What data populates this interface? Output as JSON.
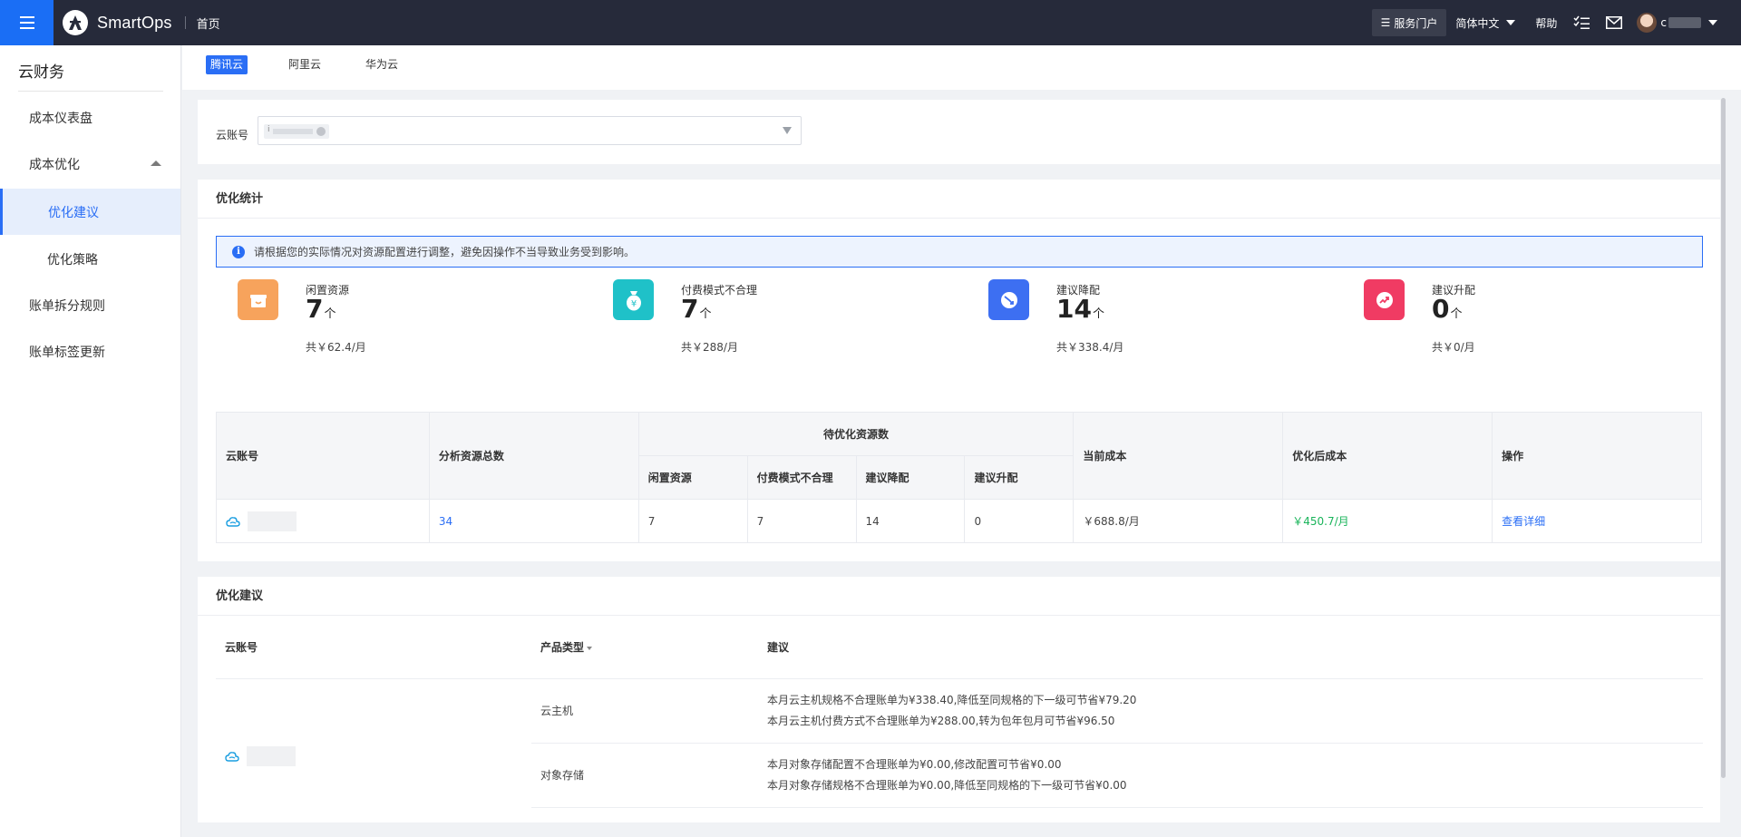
{
  "topbar": {
    "app_name": "SmartOps",
    "home": "首页",
    "portal": "服务门户",
    "language": "简体中文",
    "help": "帮助",
    "user_name": "c"
  },
  "sidebar": {
    "title": "云财务",
    "items": [
      {
        "label": "成本仪表盘"
      },
      {
        "label": "成本优化"
      },
      {
        "label": "优化建议"
      },
      {
        "label": "优化策略"
      },
      {
        "label": "账单拆分规则"
      },
      {
        "label": "账单标签更新"
      }
    ]
  },
  "tabs": [
    {
      "label": "腾讯云",
      "active": true
    },
    {
      "label": "阿里云",
      "active": false
    },
    {
      "label": "华为云",
      "active": false
    }
  ],
  "account_filter": {
    "label": "云账号",
    "chip": "i"
  },
  "stats_card": {
    "title": "优化统计",
    "notice": "请根据您的实际情况对资源配置进行调整，避免因操作不当导致业务受到影响。",
    "stats": [
      {
        "name": "闲置资源",
        "count": "7",
        "unit": "个",
        "total": "共￥62.4/月",
        "color": "#f7a35c",
        "icon": "box-icon"
      },
      {
        "name": "付费模式不合理",
        "count": "7",
        "unit": "个",
        "total": "共￥288/月",
        "color": "#1fc1c8",
        "icon": "money-bag-icon"
      },
      {
        "name": "建议降配",
        "count": "14",
        "unit": "个",
        "total": "共￥338.4/月",
        "color": "#3d6ff2",
        "icon": "downgrade-icon"
      },
      {
        "name": "建议升配",
        "count": "0",
        "unit": "个",
        "total": "共￥0/月",
        "color": "#f03b63",
        "icon": "upgrade-icon"
      }
    ],
    "table": {
      "headers": {
        "account": "云账号",
        "total": "分析资源总数",
        "pending": "待优化资源数",
        "idle": "闲置资源",
        "pay_mode": "付费模式不合理",
        "down": "建议降配",
        "up": "建议升配",
        "current_cost": "当前成本",
        "optimized_cost": "优化后成本",
        "action": "操作"
      },
      "row": {
        "total": "34",
        "idle": "7",
        "pay_mode": "7",
        "down": "14",
        "up": "0",
        "current_cost": "￥688.8/月",
        "optimized_cost": "￥450.7/月",
        "action": "查看详细"
      }
    }
  },
  "suggest_card": {
    "title": "优化建议",
    "headers": {
      "account": "云账号",
      "product": "产品类型",
      "advice": "建议"
    },
    "rows": [
      {
        "product": "云主机",
        "advice": [
          "本月云主机规格不合理账单为¥338.40,降低至同规格的下一级可节省¥79.20",
          "本月云主机付费方式不合理账单为¥288.00,转为包年包月可节省¥96.50"
        ]
      },
      {
        "product": "对象存储",
        "advice": [
          "本月对象存储配置不合理账单为¥0.00,修改配置可节省¥0.00",
          "本月对象存储规格不合理账单为¥0.00,降低至同规格的下一级可节省¥0.00"
        ]
      }
    ]
  }
}
